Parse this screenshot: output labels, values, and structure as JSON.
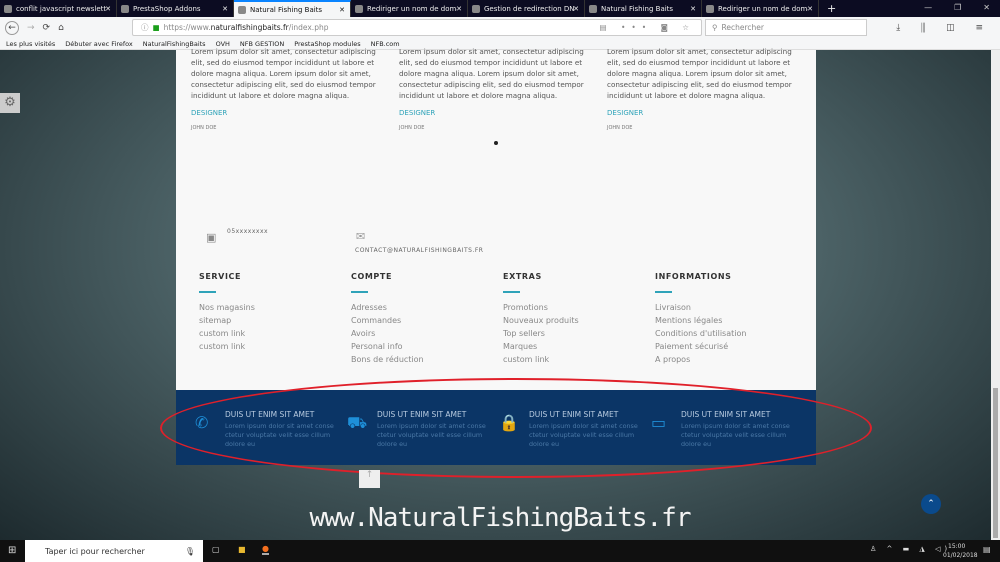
{
  "browser": {
    "tabs": [
      {
        "title": "conflit javascript newsletter - R",
        "active": false
      },
      {
        "title": "PrestaShop Addons",
        "active": false
      },
      {
        "title": "Natural Fishing Baits",
        "active": true
      },
      {
        "title": "Rediriger un nom de domaine",
        "active": false
      },
      {
        "title": "Gestion de redirection DNS (en",
        "active": false
      },
      {
        "title": "Natural Fishing Baits",
        "active": false
      },
      {
        "title": "Rediriger un nom de domaine",
        "active": false
      }
    ],
    "url_prefix": "https://www.",
    "url_domain": "naturalfishingbaits.fr",
    "url_path": "/index.php",
    "search_placeholder": "Rechercher",
    "bookmarks": [
      "Les plus visités",
      "Débuter avec Firefox",
      "NaturalFishingBaits",
      "OVH",
      "NFB GESTION",
      "PrestaShop modules",
      "NFB.com"
    ]
  },
  "testimonials": [
    {
      "text": "Lorem ipsum dolor sit amet, consectetur adipiscing elit, sed do eiusmod tempor incididunt ut labore et dolore magna aliqua. Lorem ipsum dolor sit amet, consectetur adipiscing elit, sed do eiusmod tempor incididunt ut labore et dolore magna aliqua.",
      "role": "DESIGNER",
      "name": "JOHN DOE"
    },
    {
      "text": "Lorem ipsum dolor sit amet, consectetur adipiscing elit, sed do eiusmod tempor incididunt ut labore et dolore magna aliqua. Lorem ipsum dolor sit amet, consectetur adipiscing elit, sed do eiusmod tempor incididunt ut labore et dolore magna aliqua.",
      "role": "DESIGNER",
      "name": "JOHN DOE"
    },
    {
      "text": "Lorem ipsum dolor sit amet, consectetur adipiscing elit, sed do eiusmod tempor incididunt ut labore et dolore magna aliqua. Lorem ipsum dolor sit amet, consectetur adipiscing elit, sed do eiusmod tempor incididunt ut labore et dolore magna aliqua.",
      "role": "DESIGNER",
      "name": "JOHN DOE"
    }
  ],
  "contact": {
    "phone": "05xxxxxxxx",
    "email": "CONTACT@NATURALFISHINGBAITS.FR"
  },
  "footer": [
    {
      "title": "SERVICE",
      "links": [
        "Nos magasins",
        "sitemap",
        "custom link",
        "custom link"
      ]
    },
    {
      "title": "COMPTE",
      "links": [
        "Adresses",
        "Commandes",
        "Avoirs",
        "Personal info",
        "Bons de réduction"
      ]
    },
    {
      "title": "EXTRAS",
      "links": [
        "Promotions",
        "Nouveaux produits",
        "Top sellers",
        "Marques",
        "custom link"
      ]
    },
    {
      "title": "INFORMATIONS",
      "links": [
        "Livraison",
        "Mentions légales",
        "Conditions d'utilisation",
        "Paiement sécurisé",
        "A propos"
      ]
    }
  ],
  "features": [
    {
      "icon": "phone-icon",
      "title": "DUIS UT ENIM SIT AMET",
      "text": "Lorem ipsum dolor sit amet conse ctetur voluptate velit esse cillum dolore eu"
    },
    {
      "icon": "truck-icon",
      "title": "DUIS UT ENIM SIT AMET",
      "text": "Lorem ipsum dolor sit amet conse ctetur voluptate velit esse cillum dolore eu"
    },
    {
      "icon": "lock-icon",
      "title": "DUIS UT ENIM SIT AMET",
      "text": "Lorem ipsum dolor sit amet conse ctetur voluptate velit esse cillum dolore eu"
    },
    {
      "icon": "credit-card-icon",
      "title": "DUIS UT ENIM SIT AMET",
      "text": "Lorem ipsum dolor sit amet conse ctetur voluptate velit esse cillum dolore eu"
    }
  ],
  "brand_text": "www.NaturalFishingBaits.fr",
  "taskbar": {
    "search_placeholder": "Taper ici pour rechercher",
    "time": "15:00",
    "date": "01/02/2018"
  },
  "colors": {
    "accent": "#2fa3b9",
    "band": "#0b3566",
    "annotation": "#e0202a"
  }
}
